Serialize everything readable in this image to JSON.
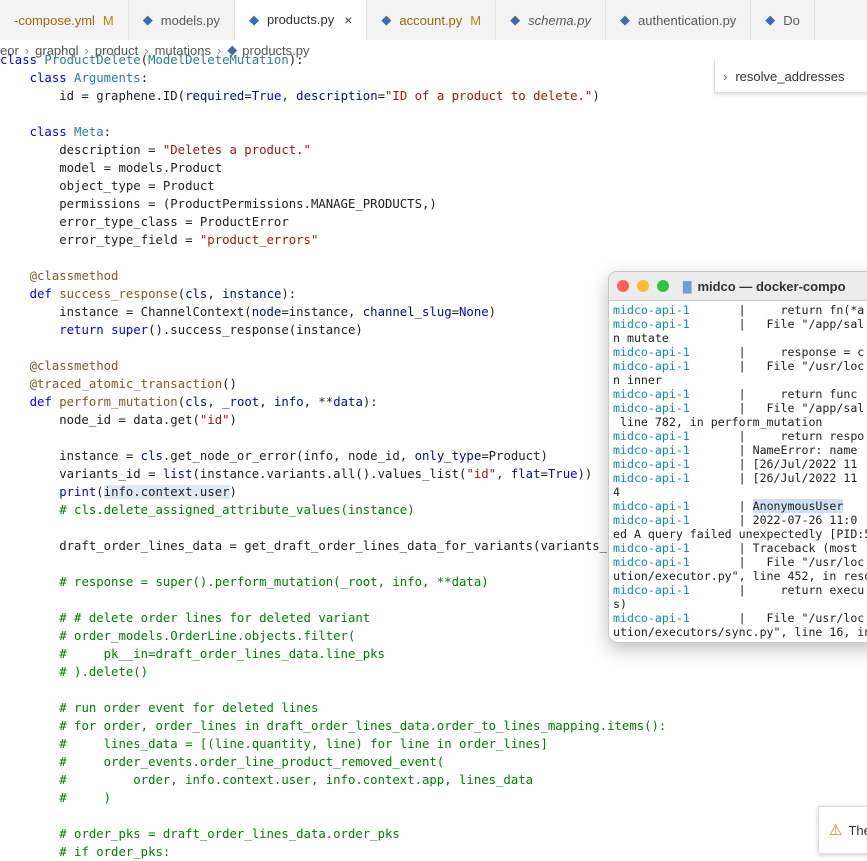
{
  "tabs": [
    {
      "name": "-compose.yml",
      "badge": "M",
      "active": false,
      "modified": true,
      "italic": false,
      "icon": "yaml"
    },
    {
      "name": "models.py",
      "badge": "",
      "active": false,
      "modified": false,
      "italic": false,
      "icon": "python-icon"
    },
    {
      "name": "products.py",
      "badge": "",
      "active": true,
      "modified": false,
      "italic": false,
      "icon": "python-icon",
      "close": "×"
    },
    {
      "name": "account.py",
      "badge": "M",
      "active": false,
      "modified": true,
      "italic": false,
      "icon": "python-icon"
    },
    {
      "name": "schema.py",
      "badge": "",
      "active": false,
      "modified": false,
      "italic": true,
      "icon": "python-icon"
    },
    {
      "name": "authentication.py",
      "badge": "",
      "active": false,
      "modified": false,
      "italic": false,
      "icon": "python-icon"
    },
    {
      "name": "Do",
      "badge": "",
      "active": false,
      "modified": false,
      "italic": false,
      "icon": "python-icon"
    }
  ],
  "breadcrumb": [
    "eor",
    "graphql",
    "product",
    "mutations",
    "products.py"
  ],
  "outline": {
    "label": "resolve_addresses"
  },
  "code_lines": [
    [
      [
        "kw",
        "class "
      ],
      [
        "cls",
        "ProductDelete"
      ],
      [
        "",
        "("
      ],
      [
        "cls",
        "ModelDeleteMutation"
      ],
      [
        "",
        "):"
      ]
    ],
    [
      [
        "",
        "    "
      ],
      [
        "kw",
        "class "
      ],
      [
        "cls",
        "Arguments"
      ],
      [
        "",
        ":"
      ]
    ],
    [
      [
        "",
        "        id = graphene.ID("
      ],
      [
        "param",
        "required"
      ],
      [
        "",
        "="
      ],
      [
        "kw",
        "True"
      ],
      [
        "",
        ", "
      ],
      [
        "param",
        "description"
      ],
      [
        "",
        "="
      ],
      [
        "str",
        "\"ID of a product to delete.\""
      ],
      [
        "",
        ")"
      ]
    ],
    [
      [
        "",
        ""
      ]
    ],
    [
      [
        "",
        "    "
      ],
      [
        "kw",
        "class "
      ],
      [
        "cls",
        "Meta"
      ],
      [
        "",
        ":"
      ]
    ],
    [
      [
        "",
        "        description = "
      ],
      [
        "str",
        "\"Deletes a product.\""
      ]
    ],
    [
      [
        "",
        "        model = models.Product"
      ]
    ],
    [
      [
        "",
        "        object_type = Product"
      ]
    ],
    [
      [
        "",
        "        permissions = (ProductPermissions.MANAGE_PRODUCTS,)"
      ]
    ],
    [
      [
        "",
        "        error_type_class = ProductError"
      ]
    ],
    [
      [
        "",
        "        error_type_field = "
      ],
      [
        "str",
        "\"product_errors\""
      ]
    ],
    [
      [
        "",
        ""
      ]
    ],
    [
      [
        "",
        "    "
      ],
      [
        "dec",
        "@classmethod"
      ]
    ],
    [
      [
        "",
        "    "
      ],
      [
        "kw",
        "def "
      ],
      [
        "fn",
        "success_response"
      ],
      [
        "",
        "("
      ],
      [
        "param",
        "cls"
      ],
      [
        "",
        ", "
      ],
      [
        "param",
        "instance"
      ],
      [
        "",
        "):"
      ]
    ],
    [
      [
        "",
        "        instance = ChannelContext("
      ],
      [
        "param",
        "node"
      ],
      [
        "",
        "=instance, "
      ],
      [
        "param",
        "channel_slug"
      ],
      [
        "",
        "="
      ],
      [
        "kw",
        "None"
      ],
      [
        "",
        ")"
      ]
    ],
    [
      [
        "",
        "        "
      ],
      [
        "kw",
        "return "
      ],
      [
        "kw",
        "super"
      ],
      [
        "",
        "().success_response(instance)"
      ]
    ],
    [
      [
        "",
        ""
      ]
    ],
    [
      [
        "",
        "    "
      ],
      [
        "dec",
        "@classmethod"
      ]
    ],
    [
      [
        "",
        "    "
      ],
      [
        "dec",
        "@traced_atomic_transaction"
      ],
      [
        "",
        "()"
      ]
    ],
    [
      [
        "",
        "    "
      ],
      [
        "kw",
        "def "
      ],
      [
        "fn",
        "perform_mutation"
      ],
      [
        "",
        "("
      ],
      [
        "param",
        "cls"
      ],
      [
        "",
        ", "
      ],
      [
        "param",
        "_root"
      ],
      [
        "",
        ", "
      ],
      [
        "param",
        "info"
      ],
      [
        "",
        ", **"
      ],
      [
        "param",
        "data"
      ],
      [
        "",
        "):"
      ]
    ],
    [
      [
        "",
        "        node_id = data.get("
      ],
      [
        "str",
        "\"id\""
      ],
      [
        "",
        ")"
      ]
    ],
    [
      [
        "",
        ""
      ]
    ],
    [
      [
        "",
        "        instance = "
      ],
      [
        "param",
        "cls"
      ],
      [
        "",
        ".get_node_or_error(info, node_id, "
      ],
      [
        "param",
        "only_type"
      ],
      [
        "",
        "=Product)"
      ]
    ],
    [
      [
        "",
        "        variants_id = "
      ],
      [
        "kw",
        "list"
      ],
      [
        "",
        "(instance.variants.all().values_list("
      ],
      [
        "str",
        "\"id\""
      ],
      [
        "",
        ", "
      ],
      [
        "param",
        "flat"
      ],
      [
        "",
        "="
      ],
      [
        "kw",
        "True"
      ],
      [
        "",
        "))"
      ]
    ],
    [
      [
        "",
        "        "
      ],
      [
        "kw",
        "print"
      ],
      [
        "",
        "("
      ],
      [
        "hl",
        "info.context.user"
      ],
      [
        "",
        ")"
      ]
    ],
    [
      [
        "",
        "        "
      ],
      [
        "com",
        "# cls.delete_assigned_attribute_values(instance)"
      ]
    ],
    [
      [
        "",
        ""
      ]
    ],
    [
      [
        "",
        "        draft_order_lines_data = get_draft_order_lines_data_for_variants(variants_id)"
      ]
    ],
    [
      [
        "",
        ""
      ]
    ],
    [
      [
        "",
        "        "
      ],
      [
        "com",
        "# response = super().perform_mutation(_root, info, **data)"
      ]
    ],
    [
      [
        "",
        ""
      ]
    ],
    [
      [
        "",
        "        "
      ],
      [
        "com",
        "# # delete order lines for deleted variant"
      ]
    ],
    [
      [
        "",
        "        "
      ],
      [
        "com",
        "# order_models.OrderLine.objects.filter("
      ]
    ],
    [
      [
        "",
        "        "
      ],
      [
        "com",
        "#     pk__in=draft_order_lines_data.line_pks"
      ]
    ],
    [
      [
        "",
        "        "
      ],
      [
        "com",
        "# ).delete()"
      ]
    ],
    [
      [
        "",
        ""
      ]
    ],
    [
      [
        "",
        "        "
      ],
      [
        "com",
        "# run order event for deleted lines"
      ]
    ],
    [
      [
        "",
        "        "
      ],
      [
        "com",
        "# for order, order_lines in draft_order_lines_data.order_to_lines_mapping.items():"
      ]
    ],
    [
      [
        "",
        "        "
      ],
      [
        "com",
        "#     lines_data = [(line.quantity, line) for line in order_lines]"
      ]
    ],
    [
      [
        "",
        "        "
      ],
      [
        "com",
        "#     order_events.order_line_product_removed_event("
      ]
    ],
    [
      [
        "",
        "        "
      ],
      [
        "com",
        "#         order, info.context.user, info.context.app, lines_data"
      ]
    ],
    [
      [
        "",
        "        "
      ],
      [
        "com",
        "#     )"
      ]
    ],
    [
      [
        "",
        ""
      ]
    ],
    [
      [
        "",
        "        "
      ],
      [
        "com",
        "# order_pks = draft_order_lines_data.order_pks"
      ]
    ],
    [
      [
        "",
        "        "
      ],
      [
        "com",
        "# if order_pks:"
      ]
    ]
  ],
  "terminal": {
    "title": "midco — docker-compo",
    "lines": [
      [
        [
          "svc",
          "midco-api-1"
        ],
        [
          "",
          "       |     return fn(*a"
        ]
      ],
      [
        [
          "svc",
          "midco-api-1"
        ],
        [
          "",
          "       |   File \"/app/sal"
        ]
      ],
      [
        [
          "",
          "n mutate"
        ]
      ],
      [
        [
          "svc",
          "midco-api-1"
        ],
        [
          "",
          "       |     response = c"
        ]
      ],
      [
        [
          "svc",
          "midco-api-1"
        ],
        [
          "",
          "       |   File \"/usr/loc"
        ]
      ],
      [
        [
          "",
          "n inner"
        ]
      ],
      [
        [
          "svc",
          "midco-api-1"
        ],
        [
          "",
          "       |     return func"
        ]
      ],
      [
        [
          "svc",
          "midco-api-1"
        ],
        [
          "",
          "       |   File \"/app/sal"
        ]
      ],
      [
        [
          "",
          " line 782, in perform_mutation"
        ]
      ],
      [
        [
          "svc",
          "midco-api-1"
        ],
        [
          "",
          "       |     return respo"
        ]
      ],
      [
        [
          "svc",
          "midco-api-1"
        ],
        [
          "",
          "       | NameError: name"
        ]
      ],
      [
        [
          "svc",
          "midco-api-1"
        ],
        [
          "",
          "       | [26/Jul/2022 11"
        ]
      ],
      [
        [
          "svc",
          "midco-api-1"
        ],
        [
          "",
          "       | [26/Jul/2022 11"
        ]
      ],
      [
        [
          "",
          "4"
        ]
      ],
      [
        [
          "svc",
          "midco-api-1"
        ],
        [
          "",
          "       | "
        ],
        [
          "user",
          "AnonymousUser"
        ]
      ],
      [
        [
          "svc",
          "midco-api-1"
        ],
        [
          "",
          "       | 2022-07-26 11:0"
        ]
      ],
      [
        [
          "",
          "ed A query failed unexpectedly [PID:5"
        ]
      ],
      [
        [
          "svc",
          "midco-api-1"
        ],
        [
          "",
          "       | Traceback (most"
        ]
      ],
      [
        [
          "svc",
          "midco-api-1"
        ],
        [
          "",
          "       |   File \"/usr/loc"
        ]
      ],
      [
        [
          "",
          "ution/executor.py\", line 452, in reso"
        ]
      ],
      [
        [
          "svc",
          "midco-api-1"
        ],
        [
          "",
          "       |     return execu"
        ]
      ],
      [
        [
          "",
          "s)"
        ]
      ],
      [
        [
          "svc",
          "midco-api-1"
        ],
        [
          "",
          "       |   File \"/usr/loc"
        ]
      ],
      [
        [
          "",
          "ution/executors/sync.py\", line 16, in"
        ]
      ]
    ]
  },
  "toast": {
    "text": "The"
  },
  "colors": {
    "traffic_red": "#fe5f57",
    "traffic_yellow": "#febc2e",
    "traffic_green": "#28c840"
  }
}
